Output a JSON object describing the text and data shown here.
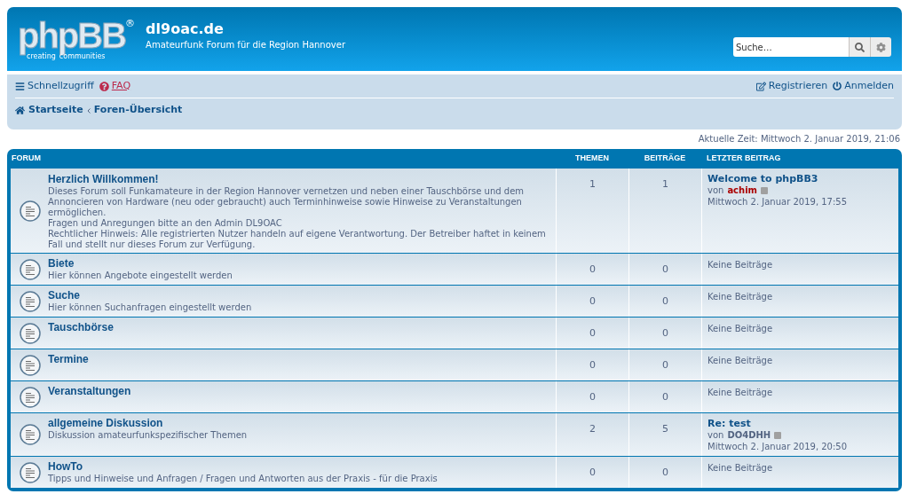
{
  "header": {
    "logo": {
      "name": "phpBB",
      "mark": "®",
      "tagline_left": "creating",
      "tagline_right": "communities"
    },
    "site_title": "dl9oac.de",
    "site_description": "Amateurfunk Forum für die Region Hannover",
    "search": {
      "placeholder": "Suche…"
    }
  },
  "navbar": {
    "quick_links": "Schnellzugriff",
    "faq": "FAQ",
    "register": "Registrieren",
    "login": "Anmelden",
    "breadcrumbs": [
      "Startseite",
      "Foren-Übersicht"
    ]
  },
  "current_time": "Aktuelle Zeit: Mittwoch 2. Januar 2019, 21:06",
  "table": {
    "columns": [
      "FORUM",
      "THEMEN",
      "BEITRÄGE",
      "LETZTER BEITRAG"
    ],
    "rows": [
      {
        "name": "Herzlich Willkommen!",
        "description": [
          "Dieses Forum soll Funkamateure in der Region Hannover vernetzen und neben einer Tauschbörse und dem Annoncieren von Hardware (neu oder gebraucht) auch Terminhinweise sowie Hinweise zu Veranstaltungen ermöglichen.",
          "Fragen und Anregungen bitte an den Admin DL9OAC",
          "Rechtlicher Hinweis: Alle registrierten Nutzer handeln auf eigene Verantwortung. Der Betreiber haftet in keinem Fall und stellt nur dieses Forum zur Verfügung."
        ],
        "topics": "1",
        "posts": "1",
        "last_post": {
          "kind": "post",
          "title": "Welcome to phpBB3",
          "by": "von",
          "author": "achim",
          "color": "#aa0000",
          "date": "Mittwoch 2. Januar 2019, 17:55"
        }
      },
      {
        "name": "Biete",
        "description": [
          "Hier können Angebote eingestellt werden"
        ],
        "topics": "0",
        "posts": "0",
        "last_post": {
          "kind": "none",
          "text": "Keine Beiträge"
        }
      },
      {
        "name": "Suche",
        "description": [
          "Hier können Suchanfragen eingestellt werden"
        ],
        "topics": "0",
        "posts": "0",
        "last_post": {
          "kind": "none",
          "text": "Keine Beiträge"
        }
      },
      {
        "name": "Tauschbörse",
        "topics": "0",
        "posts": "0",
        "last_post": {
          "kind": "none",
          "text": "Keine Beiträge"
        }
      },
      {
        "name": "Termine",
        "topics": "0",
        "posts": "0",
        "last_post": {
          "kind": "none",
          "text": "Keine Beiträge"
        }
      },
      {
        "name": "Veranstaltungen",
        "topics": "0",
        "posts": "0",
        "last_post": {
          "kind": "none",
          "text": "Keine Beiträge"
        }
      },
      {
        "name": "allgemeine Diskussion",
        "description": [
          "Diskussion amateurfunkspezifischer Themen"
        ],
        "topics": "2",
        "posts": "5",
        "last_post": {
          "kind": "post",
          "title": "Re: test",
          "by": "von",
          "author": "DO4DHH",
          "color": "#536482",
          "date": "Mittwoch 2. Januar 2019, 20:50"
        }
      },
      {
        "name": "HowTo",
        "description": [
          "Tipps und Hinweise und Anfragen / Fragen und Antworten aus der Praxis - für die Praxis"
        ],
        "topics": "0",
        "posts": "0",
        "last_post": {
          "kind": "none",
          "text": "Keine Beiträge"
        }
      }
    ]
  }
}
